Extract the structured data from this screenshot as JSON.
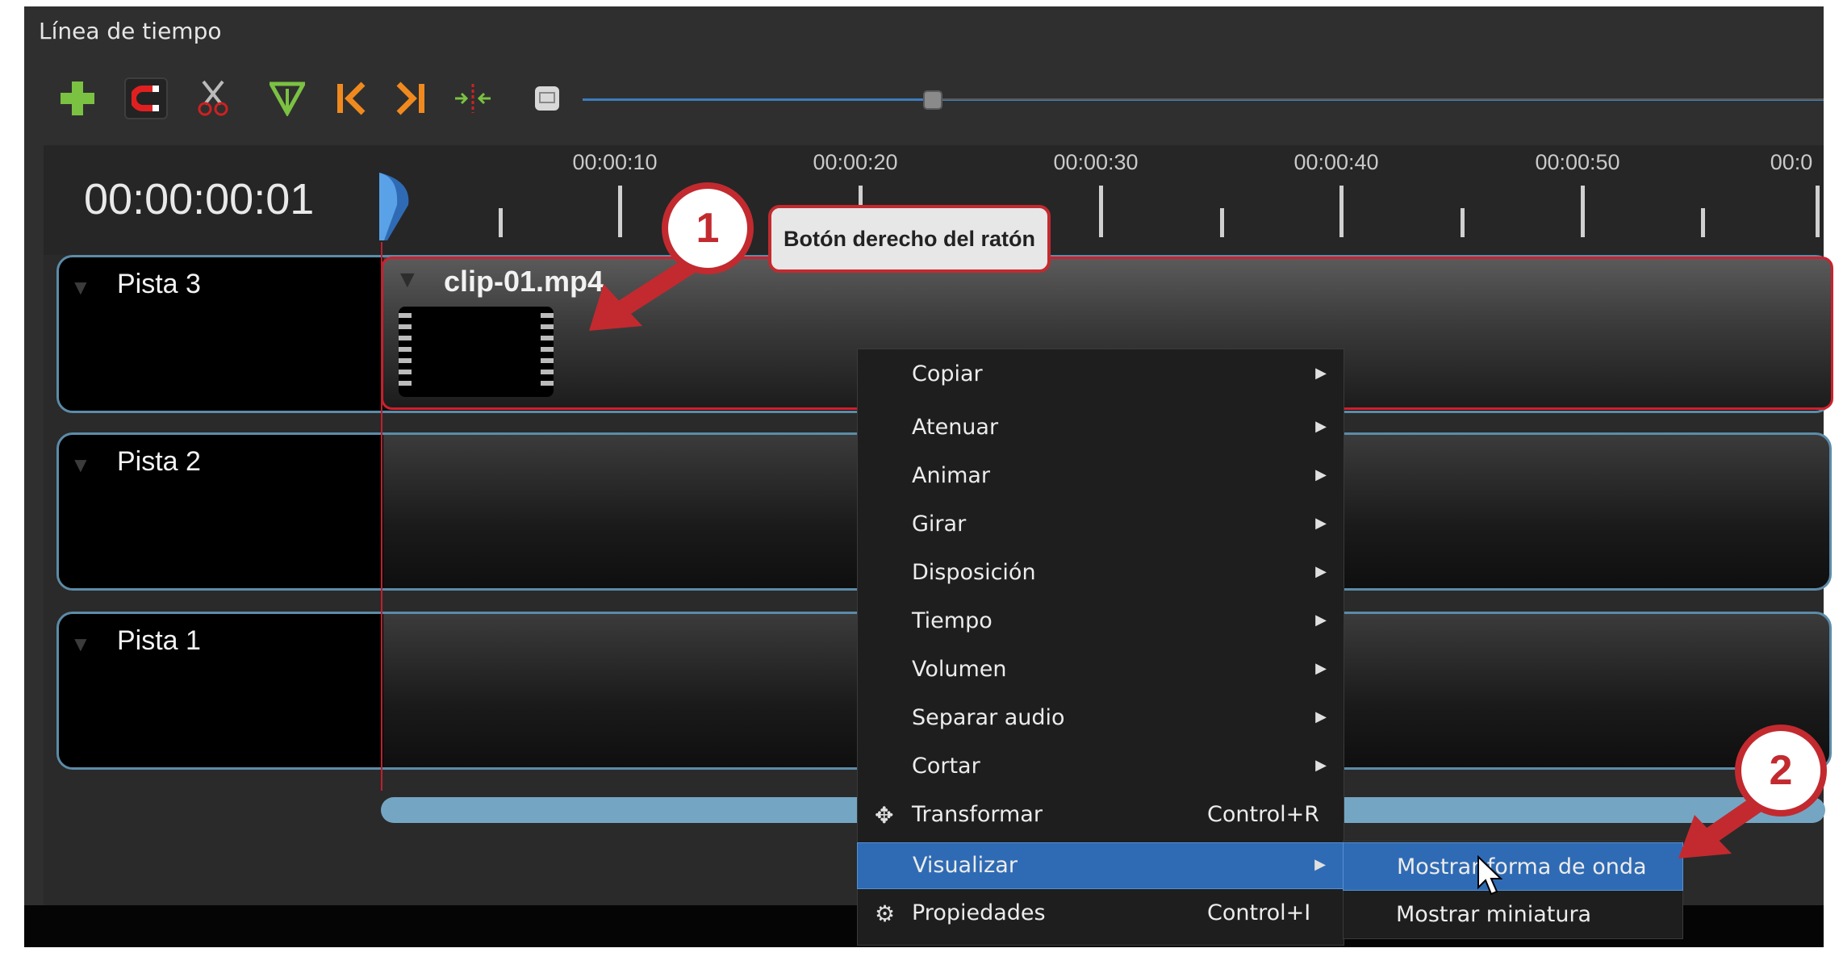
{
  "panel": {
    "title": "Línea de tiempo"
  },
  "toolbar": {
    "icons": [
      "add-track-icon",
      "snap-magnet-icon",
      "razor-icon",
      "marker-icon",
      "previous-marker-icon",
      "next-marker-icon",
      "center-playhead-icon",
      "zoom-icon"
    ]
  },
  "timeline": {
    "timecode": "00:00:00:01",
    "ticks": [
      "00:00:10",
      "00:00:20",
      "00:00:30",
      "00:00:40",
      "00:00:50",
      "00:0"
    ]
  },
  "tracks": [
    {
      "label": "Pista 3"
    },
    {
      "label": "Pista 2"
    },
    {
      "label": "Pista 1"
    }
  ],
  "clip": {
    "name": "clip-01.mp4"
  },
  "context_menu": {
    "items": [
      {
        "label": "Copiar",
        "submenu": true
      },
      {
        "label": "Atenuar",
        "submenu": true
      },
      {
        "label": "Animar",
        "submenu": true
      },
      {
        "label": "Girar",
        "submenu": true
      },
      {
        "label": "Disposición",
        "submenu": true
      },
      {
        "label": "Tiempo",
        "submenu": true
      },
      {
        "label": "Volumen",
        "submenu": true
      },
      {
        "label": "Separar audio",
        "submenu": true
      },
      {
        "label": "Cortar",
        "submenu": true
      },
      {
        "label": "Transformar",
        "shortcut": "Control+R",
        "icon": "move-icon"
      },
      {
        "label": "Visualizar",
        "submenu": true,
        "highlighted": true
      },
      {
        "label": "Propiedades",
        "shortcut": "Control+I",
        "icon": "gear-icon"
      }
    ],
    "arrow": "▶"
  },
  "submenu": {
    "items": [
      {
        "label": "Mostrar forma de onda",
        "highlighted": true
      },
      {
        "label": "Mostrar miniatura"
      }
    ]
  },
  "annotations": {
    "badge1": "1",
    "badge2": "2",
    "callout": "Botón derecho del ratón"
  },
  "colors": {
    "accent_red": "#c22a2f",
    "highlight_blue": "#2f6bb4",
    "track_border": "#5c8ca8",
    "scrollbar": "#74a6c3"
  }
}
